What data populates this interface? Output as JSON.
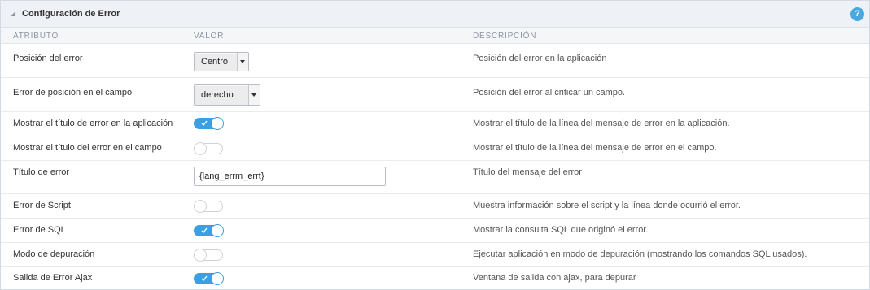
{
  "panel": {
    "title": "Configuración de Error",
    "help_label": "?"
  },
  "columns": {
    "attribute": "ATRIBUTO",
    "value": "VALOR",
    "description": "DESCRIPCIÓN"
  },
  "rows": [
    {
      "attribute": "Posición del error",
      "control": "select",
      "value": "Centro",
      "description": "Posición del error en la aplicación"
    },
    {
      "attribute": "Error de posición en el campo",
      "control": "select",
      "value": "derecho",
      "description": "Posición del error al criticar un campo."
    },
    {
      "attribute": "Mostrar el título de error en la aplicación",
      "control": "toggle",
      "value": "on",
      "description": "Mostrar el título de la línea del mensaje de error en la aplicación."
    },
    {
      "attribute": "Mostrar el título del error en el campo",
      "control": "toggle",
      "value": "off",
      "description": "Mostrar el título de la línea del mensaje de error en el campo."
    },
    {
      "attribute": "Título de error",
      "control": "text",
      "value": "{lang_errm_errt}",
      "description": "Título del mensaje del error"
    },
    {
      "attribute": "Error de Script",
      "control": "toggle",
      "value": "off",
      "description": "Muestra información sobre el script y la línea donde ocurrió el error."
    },
    {
      "attribute": "Error de SQL",
      "control": "toggle",
      "value": "on",
      "description": "Mostrar la consulta SQL que originó el error."
    },
    {
      "attribute": "Modo de depuración",
      "control": "toggle",
      "value": "off",
      "description": "Ejecutar aplicación en modo de depuración (mostrando los comandos SQL usados)."
    },
    {
      "attribute": "Salida de Error Ajax",
      "control": "toggle",
      "value": "on",
      "description": "Ventana de salida con ajax, para depurar"
    }
  ],
  "colors": {
    "accent": "#3aa0e3",
    "header_bg": "#eef1f5",
    "help_icon": "#4aa8e0"
  },
  "icons": {
    "collapse": "triangle-collapse-icon",
    "help": "help-icon",
    "dropdown": "chevron-down-icon",
    "toggle_on": "check-icon"
  }
}
